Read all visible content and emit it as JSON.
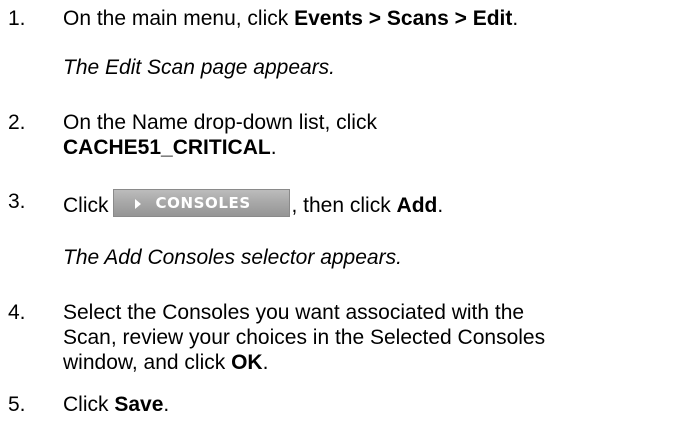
{
  "steps": [
    {
      "number": "1.",
      "prefix": "On the main menu, click ",
      "bold": "Events > Scans > Edit",
      "suffix": ".",
      "note": "The Edit Scan page appears."
    },
    {
      "number": "2.",
      "line1": "On the Name drop-down list, click",
      "bold": "CACHE51_CRITICAL",
      "suffix": "."
    },
    {
      "number": "3.",
      "prefix": "Click",
      "button_label": "CONSOLES",
      "middle": ", then click ",
      "bold": "Add",
      "suffix": ".",
      "note": "The Add Consoles selector appears."
    },
    {
      "number": "4.",
      "line1": "Select the Consoles you want associated with the",
      "line2": "Scan, review your choices in the Selected Consoles",
      "line3_prefix": "window, and click ",
      "bold": "OK",
      "suffix": "."
    },
    {
      "number": "5.",
      "prefix": "Click ",
      "bold": "Save",
      "suffix": "."
    }
  ],
  "colors": {
    "text": "#000000",
    "button_top": "#bcbcbc",
    "button_bottom": "#959595",
    "button_text": "#ffffff"
  }
}
